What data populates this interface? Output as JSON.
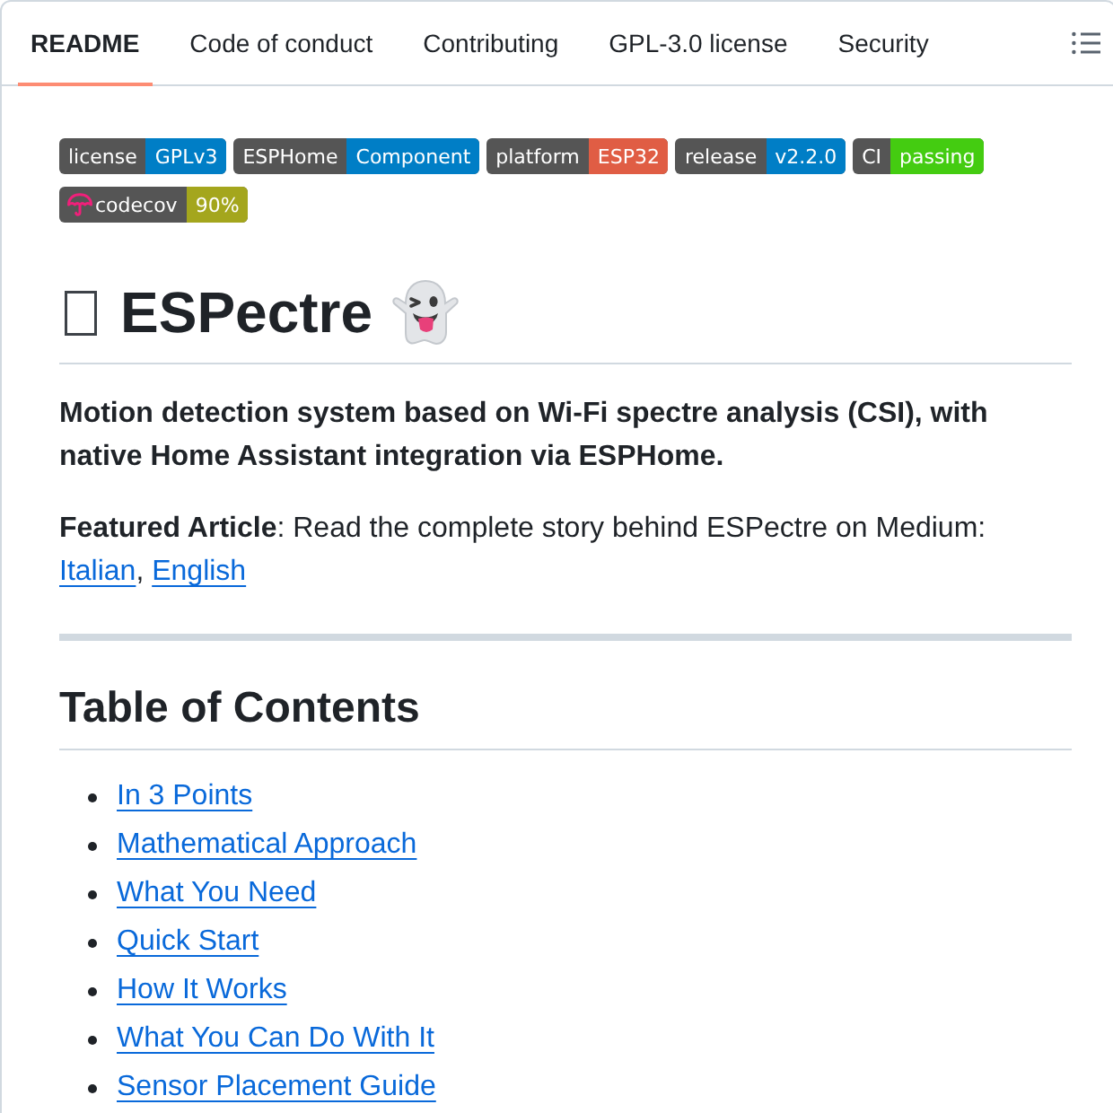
{
  "tabs": [
    {
      "label": "README",
      "selected": true
    },
    {
      "label": "Code of conduct",
      "selected": false
    },
    {
      "label": "Contributing",
      "selected": false
    },
    {
      "label": "GPL-3.0 license",
      "selected": false
    },
    {
      "label": "Security",
      "selected": false
    }
  ],
  "badges": [
    {
      "kind": "plain",
      "label": "license",
      "message": "GPLv3",
      "color": "#007ec6"
    },
    {
      "kind": "plain",
      "label": "ESPHome",
      "message": "Component",
      "color": "#007ec6"
    },
    {
      "kind": "plain",
      "label": "platform",
      "message": "ESP32",
      "color": "#e05d44"
    },
    {
      "kind": "plain",
      "label": "release",
      "message": "v2.2.0",
      "color": "#007ec6"
    },
    {
      "kind": "plain",
      "label": "CI",
      "message": "passing",
      "color": "#44cc11"
    },
    {
      "kind": "logo",
      "label": "codecov",
      "message": "90%",
      "color": "#a4a61d"
    }
  ],
  "title": "ESPectre",
  "description": "Motion detection system based on Wi-Fi spectre analysis (CSI), with native Home Assistant integration via ESPHome.",
  "featured": {
    "text": "**Featured Article**: Read the complete story behind ESPectre on Medium:",
    "links": [
      {
        "label": "Italian"
      },
      {
        "label": "English"
      }
    ],
    "separator": ","
  },
  "toc": {
    "heading": "Table of Contents",
    "items": [
      {
        "label": "In 3 Points"
      },
      {
        "label": "Mathematical Approach"
      },
      {
        "label": "What You Need"
      },
      {
        "label": "Quick Start"
      },
      {
        "label": "How It Works"
      },
      {
        "label": "What You Can Do With It"
      },
      {
        "label": "Sensor Placement Guide"
      }
    ]
  }
}
